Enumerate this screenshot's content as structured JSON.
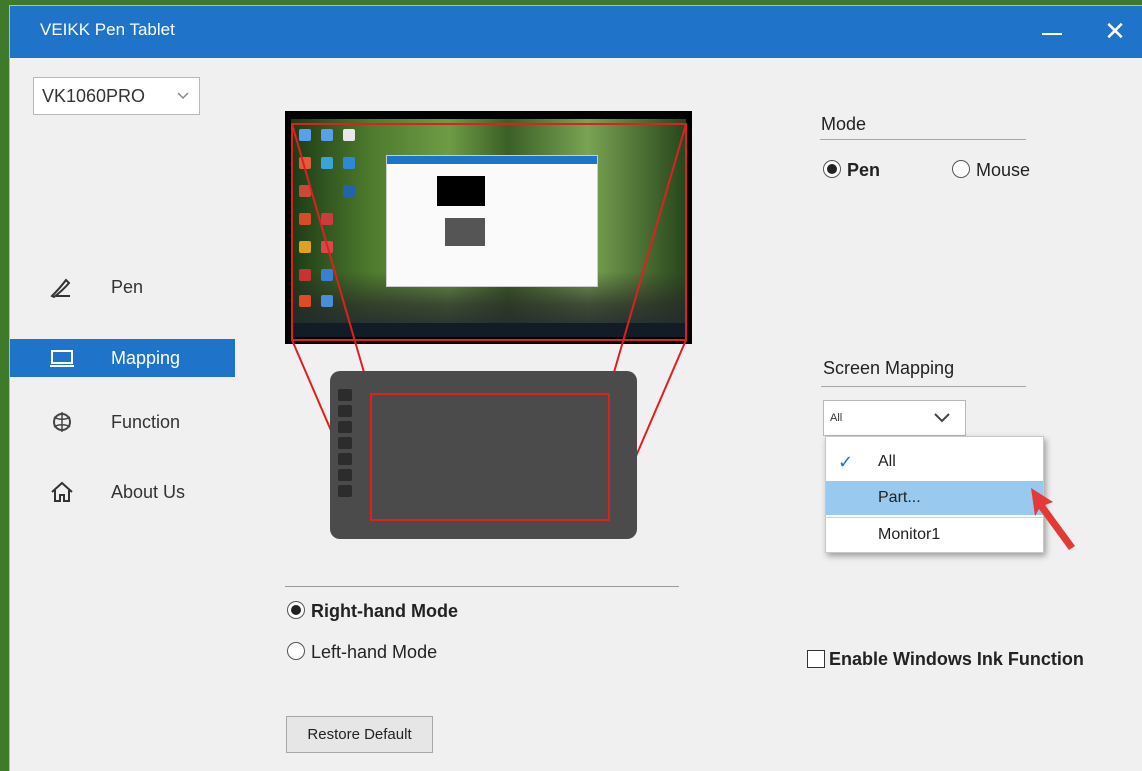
{
  "window": {
    "title": "VEIKK Pen Tablet",
    "minimize_icon": "minimize-icon",
    "close_icon": "close-icon",
    "close_glyph": "✕"
  },
  "sidebar": {
    "model": {
      "selected": "VK1060PRO",
      "icon": "chevron-down-icon"
    },
    "items": [
      {
        "label": "Pen",
        "icon": "pen-icon",
        "active": false
      },
      {
        "label": "Mapping",
        "icon": "monitor-icon",
        "active": true
      },
      {
        "label": "Function",
        "icon": "function-icon",
        "active": false
      },
      {
        "label": "About Us",
        "icon": "home-icon",
        "active": false
      }
    ]
  },
  "hand_mode": {
    "options": [
      {
        "label": "Right-hand Mode",
        "checked": true
      },
      {
        "label": "Left-hand Mode",
        "checked": false
      }
    ]
  },
  "restore_button": {
    "label": "Restore Default"
  },
  "mode": {
    "title": "Mode",
    "options": [
      {
        "label": "Pen",
        "checked": true
      },
      {
        "label": "Mouse",
        "checked": false
      }
    ]
  },
  "screen_mapping": {
    "title": "Screen Mapping",
    "selected": "All",
    "options": [
      {
        "label": "All",
        "checked": true,
        "highlighted": false
      },
      {
        "label": "Part...",
        "checked": false,
        "highlighted": true
      },
      {
        "label": "Monitor1",
        "checked": false,
        "highlighted": false
      }
    ]
  },
  "windows_ink": {
    "label": "Enable Windows Ink Function",
    "checked": false
  },
  "colors": {
    "accent": "#1f73c8",
    "mapping_line": "#e02020",
    "dropdown_highlight": "#99c9ef",
    "arrow": "#e53935"
  }
}
